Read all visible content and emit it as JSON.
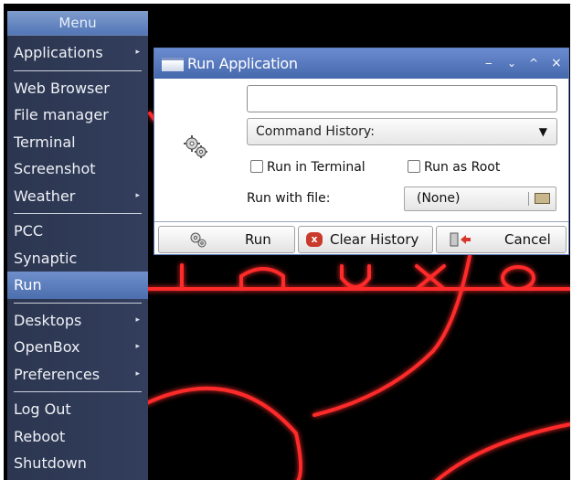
{
  "menu": {
    "title": "Menu",
    "items": [
      {
        "label": "Applications",
        "submenu": true
      },
      {
        "label": "Web Browser",
        "submenu": false
      },
      {
        "label": "File manager",
        "submenu": false
      },
      {
        "label": "Terminal",
        "submenu": false
      },
      {
        "label": "Screenshot",
        "submenu": false
      },
      {
        "label": "Weather",
        "submenu": true
      },
      {
        "label": "PCC",
        "submenu": false
      },
      {
        "label": "Synaptic",
        "submenu": false
      },
      {
        "label": "Run",
        "submenu": false,
        "active": true
      },
      {
        "label": "Desktops",
        "submenu": true
      },
      {
        "label": "OpenBox",
        "submenu": true
      },
      {
        "label": "Preferences",
        "submenu": true
      },
      {
        "label": "Log Out",
        "submenu": false
      },
      {
        "label": "Reboot",
        "submenu": false
      },
      {
        "label": "Shutdown",
        "submenu": false
      }
    ],
    "submenu_arrow": "▸"
  },
  "dialog": {
    "title": "Run Application",
    "controls": {
      "minimize": "‒",
      "shade": "⌄",
      "maximize": "^",
      "close": "×"
    },
    "command_value": "",
    "history_label": "Command History:",
    "history_arrow": "▼",
    "run_in_terminal_label": "Run in Terminal",
    "run_in_terminal_checked": false,
    "run_as_root_label": "Run as Root",
    "run_as_root_checked": false,
    "run_with_file_label": "Run with file:",
    "file_value": "(None)",
    "buttons": {
      "run": "Run",
      "clear_history": "Clear History",
      "cancel": "Cancel"
    },
    "icons": {
      "main": "gears-icon",
      "run": "gears-icon",
      "clear": "clear-x-icon",
      "cancel": "exit-door-icon",
      "file": "folder-icon"
    }
  },
  "wallpaper": {
    "text": "inuxo",
    "accent_color": "#ff2a2a"
  }
}
